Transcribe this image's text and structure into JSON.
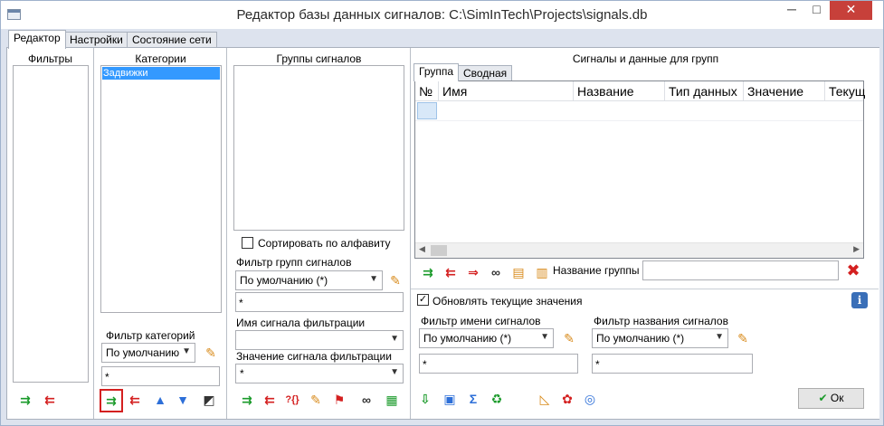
{
  "window": {
    "title": "Редактор базы данных сигналов: C:\\SimInTech\\Projects\\signals.db",
    "min_glyph": "─",
    "max_glyph": "□",
    "close_glyph": "✕"
  },
  "tabs": [
    "Редактор",
    "Настройки",
    "Состояние сети"
  ],
  "filters": {
    "header": "Фильтры"
  },
  "categories": {
    "header": "Категории",
    "items": [
      "Задвижки"
    ],
    "filter_label": "Фильтр категорий",
    "filter_value": "По умолчанию",
    "filter_text": "*"
  },
  "groups": {
    "header": "Группы сигналов",
    "sort_label": "Сортировать по алфавиту",
    "sort_checked": false,
    "filter_label": "Фильтр групп сигналов",
    "filter_value": "По умолчанию (*)",
    "filter_text": "*",
    "signal_name_filter_label": "Имя сигнала фильтрации",
    "signal_name_filter_value": "",
    "signal_value_filter_label": "Значение сигнала фильтрации",
    "signal_value_filter_value": "*"
  },
  "signals": {
    "header": "Сигналы и данные для групп",
    "tabs": [
      "Группа",
      "Сводная"
    ],
    "columns": [
      "№",
      "Имя",
      "Название",
      "Тип данных",
      "Значение",
      "Текущ"
    ],
    "group_name_label": "Название группы",
    "group_name_value": "",
    "update_label": "Обновлять текущие значения",
    "update_checked": true,
    "signal_name_filter_label": "Фильтр имени сигналов",
    "signal_name_filter_value": "По умолчанию (*)",
    "signal_name_filter_text": "*",
    "signal_title_filter_label": "Фильтр названия сигналов",
    "signal_title_filter_value": "По умолчанию (*)",
    "signal_title_filter_text": "*",
    "sum_glyph": "Σ"
  },
  "ok_button": "Ок"
}
